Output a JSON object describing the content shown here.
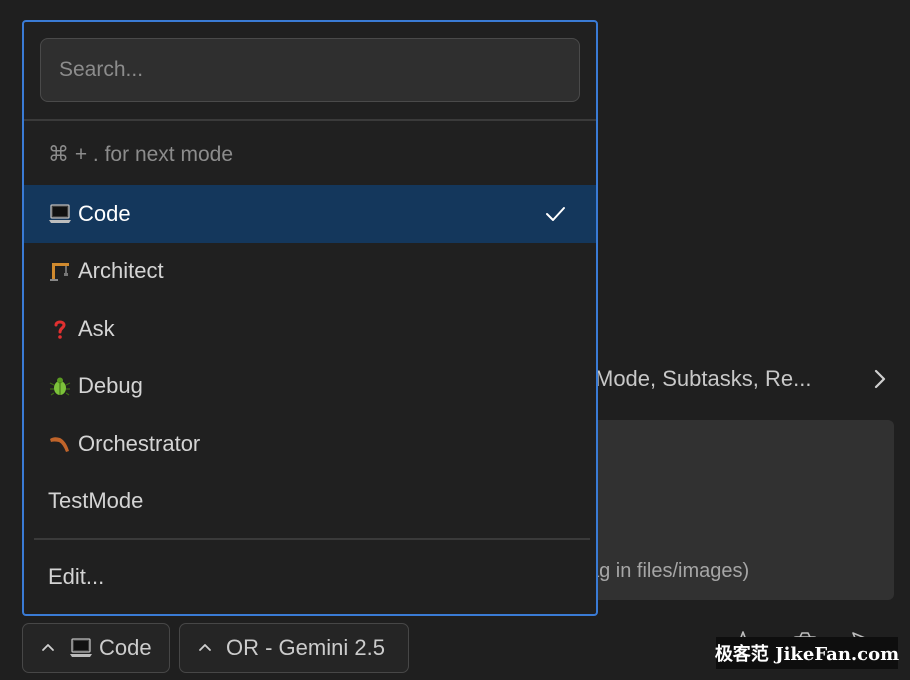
{
  "background": {
    "settings_row": "Mode, Subtasks, Re...",
    "input_placeholder": "ag in files/images)"
  },
  "dropdown": {
    "search_placeholder": "Search...",
    "hint": "⌘ + . for next mode",
    "items": [
      {
        "label": "Code",
        "icon": "laptop-icon",
        "selected": true
      },
      {
        "label": "Architect",
        "icon": "construction-crane-icon",
        "selected": false
      },
      {
        "label": "Ask",
        "icon": "question-mark-icon",
        "selected": false
      },
      {
        "label": "Debug",
        "icon": "bug-icon",
        "selected": false
      },
      {
        "label": "Orchestrator",
        "icon": "boomerang-icon",
        "selected": false
      },
      {
        "label": "TestMode",
        "icon": "",
        "selected": false
      }
    ],
    "edit_label": "Edit..."
  },
  "bottom_bar": {
    "mode_label": "Code",
    "mode_icon": "laptop-icon",
    "model_label": "OR - Gemini 2.5"
  },
  "watermark": "极客范 JikeFan.com",
  "colors": {
    "accent_border": "#3a7bd5",
    "selected_bg": "#14375c",
    "background": "#1f1f1f"
  }
}
